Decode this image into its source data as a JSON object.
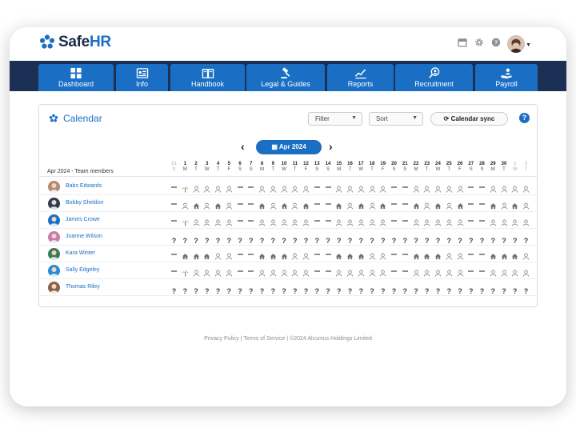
{
  "brand": {
    "name_part1": "Safe",
    "name_part2": "HR",
    "accent": "#1a6fc4",
    "nav_bg": "#1c2f55"
  },
  "top_icons": [
    "calendar-icon",
    "gear-icon",
    "help-icon"
  ],
  "nav": [
    {
      "label": "Dashboard",
      "icon": "dashboard-icon"
    },
    {
      "label": "Info",
      "icon": "info-card-icon"
    },
    {
      "label": "Handbook",
      "icon": "book-icon"
    },
    {
      "label": "Legal & Guides",
      "icon": "gavel-icon"
    },
    {
      "label": "Reports",
      "icon": "chart-icon"
    },
    {
      "label": "Recruitment",
      "icon": "search-person-icon"
    },
    {
      "label": "Payroll",
      "icon": "hand-person-icon"
    }
  ],
  "calendar": {
    "title": "Calendar",
    "filter_label": "Filter",
    "sort_label": "Sort",
    "sync_label": "Calendar sync",
    "help": "?",
    "month_label": "Apr 2024",
    "prev": "‹",
    "next": "›",
    "team_header": "Apr 2024 - Team members",
    "days": [
      {
        "n": "31",
        "l": "S",
        "dim": true
      },
      {
        "n": "1",
        "l": "M"
      },
      {
        "n": "2",
        "l": "T"
      },
      {
        "n": "3",
        "l": "W"
      },
      {
        "n": "4",
        "l": "T"
      },
      {
        "n": "5",
        "l": "F"
      },
      {
        "n": "6",
        "l": "S"
      },
      {
        "n": "7",
        "l": "S"
      },
      {
        "n": "8",
        "l": "M"
      },
      {
        "n": "9",
        "l": "T"
      },
      {
        "n": "10",
        "l": "W"
      },
      {
        "n": "11",
        "l": "T"
      },
      {
        "n": "12",
        "l": "F"
      },
      {
        "n": "13",
        "l": "S"
      },
      {
        "n": "14",
        "l": "S"
      },
      {
        "n": "15",
        "l": "M"
      },
      {
        "n": "16",
        "l": "T"
      },
      {
        "n": "17",
        "l": "W"
      },
      {
        "n": "18",
        "l": "T"
      },
      {
        "n": "19",
        "l": "F"
      },
      {
        "n": "20",
        "l": "S"
      },
      {
        "n": "21",
        "l": "S"
      },
      {
        "n": "22",
        "l": "M"
      },
      {
        "n": "23",
        "l": "T"
      },
      {
        "n": "24",
        "l": "W"
      },
      {
        "n": "25",
        "l": "T"
      },
      {
        "n": "26",
        "l": "F"
      },
      {
        "n": "27",
        "l": "S"
      },
      {
        "n": "28",
        "l": "S"
      },
      {
        "n": "29",
        "l": "M"
      },
      {
        "n": "30",
        "l": "T"
      },
      {
        "n": "1",
        "l": "W",
        "dim": true
      },
      {
        "n": "2",
        "l": "T",
        "dim": true
      }
    ],
    "members": [
      {
        "name": "Babs Edwards",
        "avatar_color": "#b48a74",
        "cells": "DVPPPPDDPPPPPDDPPPPPDDPPPPPDDPPPP"
      },
      {
        "name": "Bobby Sheldon",
        "avatar_color": "#2c3e50",
        "cells": "DPHPHPDDHPHPHDDHPHPHDDHPHPHDDHPHP"
      },
      {
        "name": "James Crowe",
        "avatar_color": "#1a6fc4",
        "cells": "DVPPPPDDPPPPPDDPPPPPDDPPPPPDDPPPP"
      },
      {
        "name": "Joanne Wilson",
        "avatar_color": "#c77dab",
        "cells": "QQQQQQQQQQQQQQQQQQQQQQQQQQQQQQQQQ"
      },
      {
        "name": "Kara Winter",
        "avatar_color": "#3b7a57",
        "cells": "DHHHPPDDHHHPPDDHHHPPDDHHHPPDDHHHP"
      },
      {
        "name": "Sally Edgeley",
        "avatar_color": "#2a8cd4",
        "cells": "DVPPPPDDPPPPPDDPPPPPDDPPPPPDDPPPP"
      },
      {
        "name": "Thomas Riley",
        "avatar_color": "#8a6248",
        "cells": "QQQQQQQQQQQQQQQQQQQQQQQQQQQQQQQQQ"
      }
    ]
  },
  "footer": "Privacy Policy | Terms of Service | ©2024 Alcumus Holdings Limited"
}
